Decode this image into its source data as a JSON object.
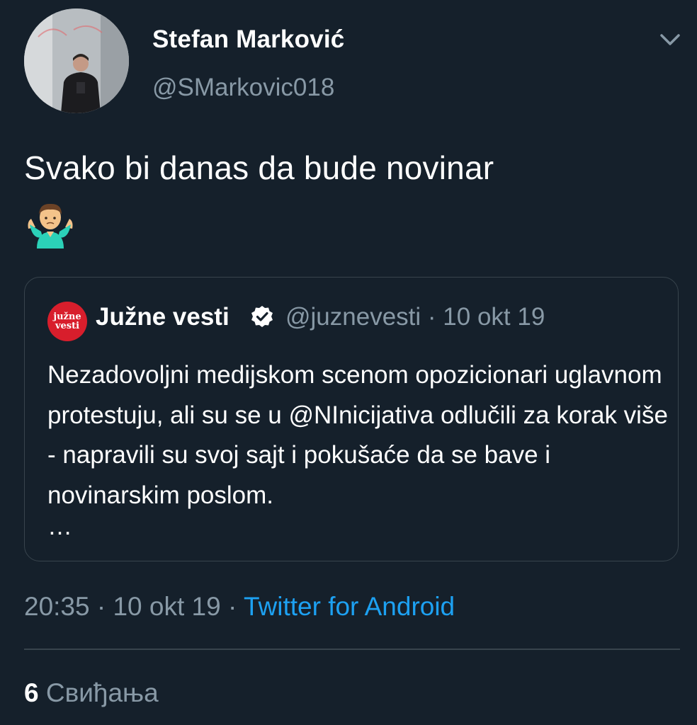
{
  "tweet": {
    "author": {
      "display_name": "Stefan Marković",
      "handle": "@SMarkovic018",
      "avatar_icon": "avatar-photo"
    },
    "menu_icon": "chevron-down-icon",
    "text": "Svako bi danas da bude novinar",
    "emoji": "🤷‍♂️",
    "quoted": {
      "logo_line1": "južne",
      "logo_line2": "vesti",
      "display_name": "Južne vesti",
      "verified_icon": "verified-badge-icon",
      "handle": "@juznevesti",
      "separator": "·",
      "date": "10 okt 19",
      "text": "Nezadovoljni medijskom scenom opozicionari uglavnom protestuju, ali su se u @NInicijativa odlučili za korak više - napravili su svoj sajt i pokušaće da se bave i novinarskim poslom.",
      "ellipsis": "…"
    },
    "time": "20:35",
    "separator": "·",
    "date": "10 okt 19",
    "source": "Twitter for Android",
    "likes_count": "6",
    "likes_label": "Свиђања"
  },
  "colors": {
    "background": "#15202b",
    "secondary_text": "#8899a6",
    "link": "#1da1f2",
    "border": "#38444d",
    "logo_red": "#d81e2c"
  }
}
